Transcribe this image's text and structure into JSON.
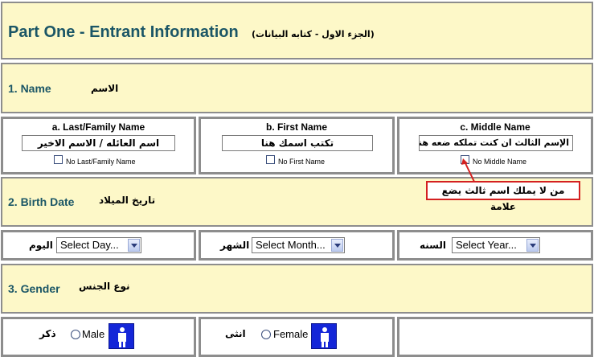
{
  "header": {
    "title": "Part One - Entrant Information",
    "title_ar": "(الجزء الاول - كتابه البيانات)"
  },
  "name_section": {
    "label": "1. Name",
    "label_ar": "الاسم",
    "last": {
      "title": "a. Last/Family Name",
      "value": "اسم العائله / الاسم الاخير",
      "checkbox_label": "No Last/Family Name"
    },
    "first": {
      "title": "b. First Name",
      "value": "تكتب اسمك هنا",
      "checkbox_label": "No First Name"
    },
    "middle": {
      "title": "c. Middle Name",
      "value": "الإسم الثالث ان كنت تملكه ضعه هنا",
      "checkbox_label": "No Middle Name"
    },
    "callout": "من لا يملك اسم ثالث يضع علامة"
  },
  "birth_section": {
    "label": "2. Birth Date",
    "label_ar": "تاريخ الميلاد",
    "day_label_ar": "اليوم",
    "day_select": "Select Day...",
    "month_label_ar": "الشهر",
    "month_select": "Select Month...",
    "year_label_ar": "السنه",
    "year_select": "Select Year..."
  },
  "gender_section": {
    "label": "3. Gender",
    "label_ar": "نوع الجنس",
    "male_ar": "ذكر",
    "male_label": "Male",
    "female_ar": "انثى",
    "female_label": "Female"
  },
  "icons": {
    "checkbox": "checkbox-icon",
    "dropdown": "chevron-down-icon",
    "male": "male-person-icon",
    "female": "female-person-icon"
  },
  "colors": {
    "band_bg": "#fdf8c8",
    "heading_teal": "#1b5666",
    "border_gray": "#8d8d8d",
    "callout_red": "#d42020",
    "person_blue": "#1426d8"
  }
}
